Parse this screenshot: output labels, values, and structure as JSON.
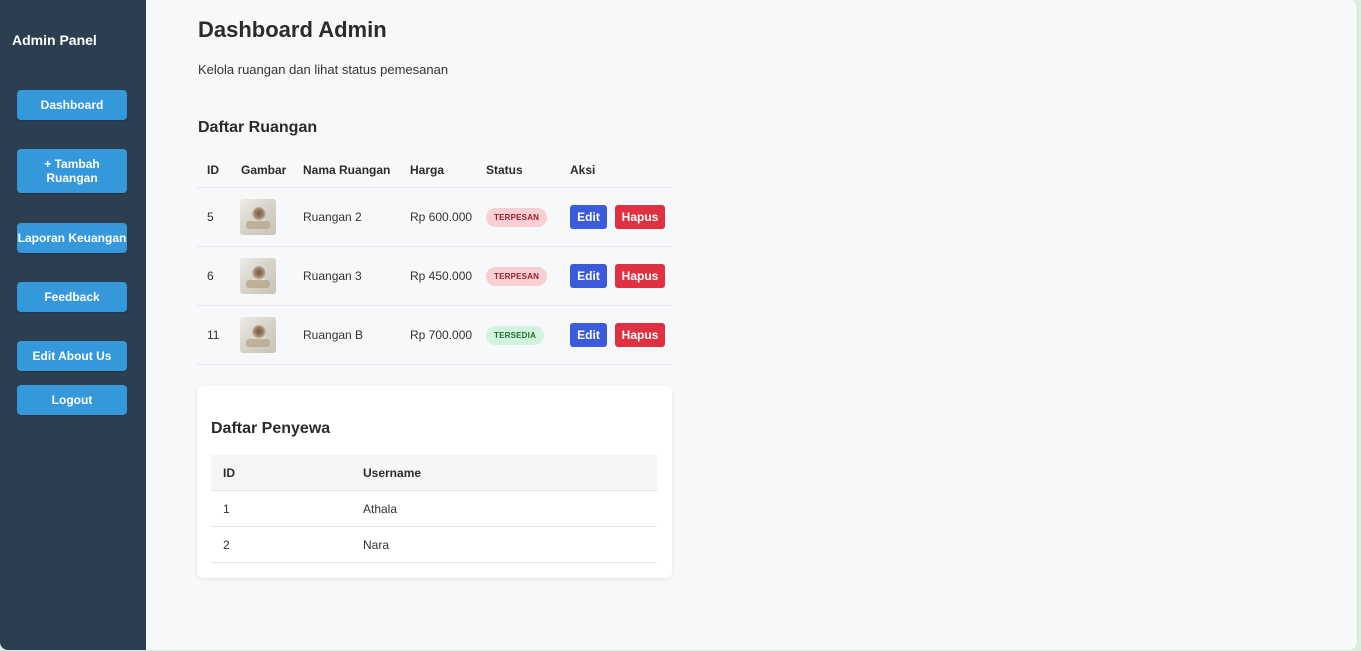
{
  "sidebar": {
    "title": "Admin Panel",
    "items": [
      {
        "label": "Dashboard"
      },
      {
        "label": "+ Tambah Ruangan"
      },
      {
        "label": "Laporan Keuangan"
      },
      {
        "label": "Feedback"
      },
      {
        "label": "Edit About Us"
      },
      {
        "label": "Logout"
      }
    ],
    "colors": {
      "background": "#2c3e50",
      "button": "#3498db"
    }
  },
  "header": {
    "title": "Dashboard Admin",
    "subtitle": "Kelola ruangan dan lihat status pemesanan"
  },
  "rooms": {
    "title": "Daftar Ruangan",
    "columns": [
      "ID",
      "Gambar",
      "Nama Ruangan",
      "Harga",
      "Status",
      "Aksi"
    ],
    "rows": [
      {
        "id": "5",
        "image_icon": "room-thumbnail",
        "name": "Ruangan 2",
        "price": "Rp 600.000",
        "status": "TERPESAN",
        "status_type": "booked",
        "edit_label": "Edit",
        "delete_label": "Hapus"
      },
      {
        "id": "6",
        "image_icon": "room-thumbnail",
        "name": "Ruangan 3",
        "price": "Rp 450.000",
        "status": "TERPESAN",
        "status_type": "booked",
        "edit_label": "Edit",
        "delete_label": "Hapus"
      },
      {
        "id": "11",
        "image_icon": "room-thumbnail",
        "name": "Ruangan B",
        "price": "Rp 700.000",
        "status": "TERSEDIA",
        "status_type": "available",
        "edit_label": "Edit",
        "delete_label": "Hapus"
      }
    ],
    "colors": {
      "edit": "#3b5bdb",
      "delete": "#e03143",
      "booked_bg": "#f8d0d4",
      "available_bg": "#d4f3dc"
    }
  },
  "tenants": {
    "title": "Daftar Penyewa",
    "columns": [
      "ID",
      "Username"
    ],
    "rows": [
      {
        "id": "1",
        "username": "Athala"
      },
      {
        "id": "2",
        "username": "Nara"
      }
    ]
  }
}
